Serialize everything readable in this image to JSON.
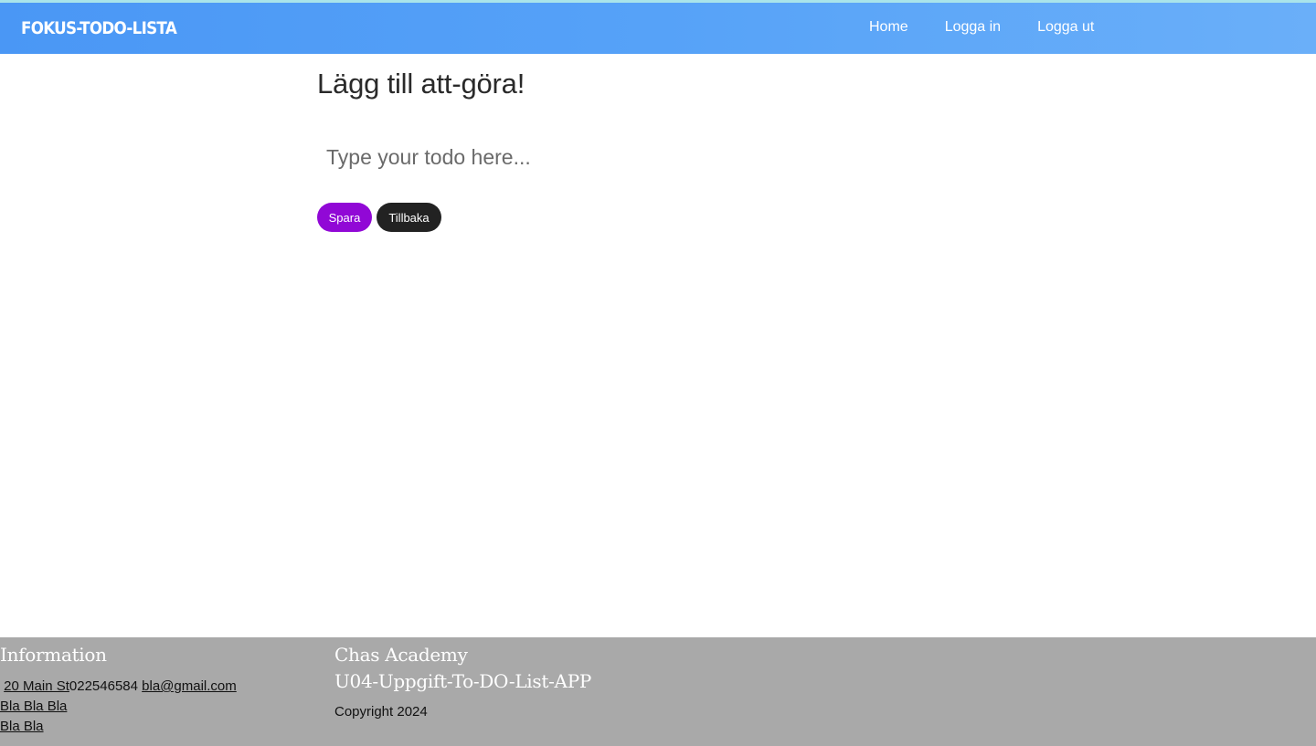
{
  "header": {
    "brand": "FOKUS-TODO-LISTA",
    "nav": {
      "home": "Home",
      "login": "Logga in",
      "logout": "Logga ut"
    }
  },
  "main": {
    "title": "Lägg till att-göra!",
    "input": {
      "placeholder": "Type your todo here...",
      "value": ""
    },
    "buttons": {
      "save": "Spara",
      "back": "Tillbaka"
    }
  },
  "footer": {
    "info": {
      "heading": "Information",
      "address": "20 Main St",
      "phone": "022546584",
      "email": "bla@gmail.com",
      "link1": "Bla Bla Bla",
      "link2": "Bla Bla"
    },
    "academy": {
      "heading": "Chas Academy",
      "subheading": "U04-Uppgift-To-DO-List-APP",
      "copyright": "Copyright 2024"
    }
  },
  "colors": {
    "nav_gradient_start": "#4a97f5",
    "nav_gradient_end": "#6aaff9",
    "save_button": "#9108d6",
    "back_button": "#222222",
    "footer_bg": "#a9a9a9"
  }
}
